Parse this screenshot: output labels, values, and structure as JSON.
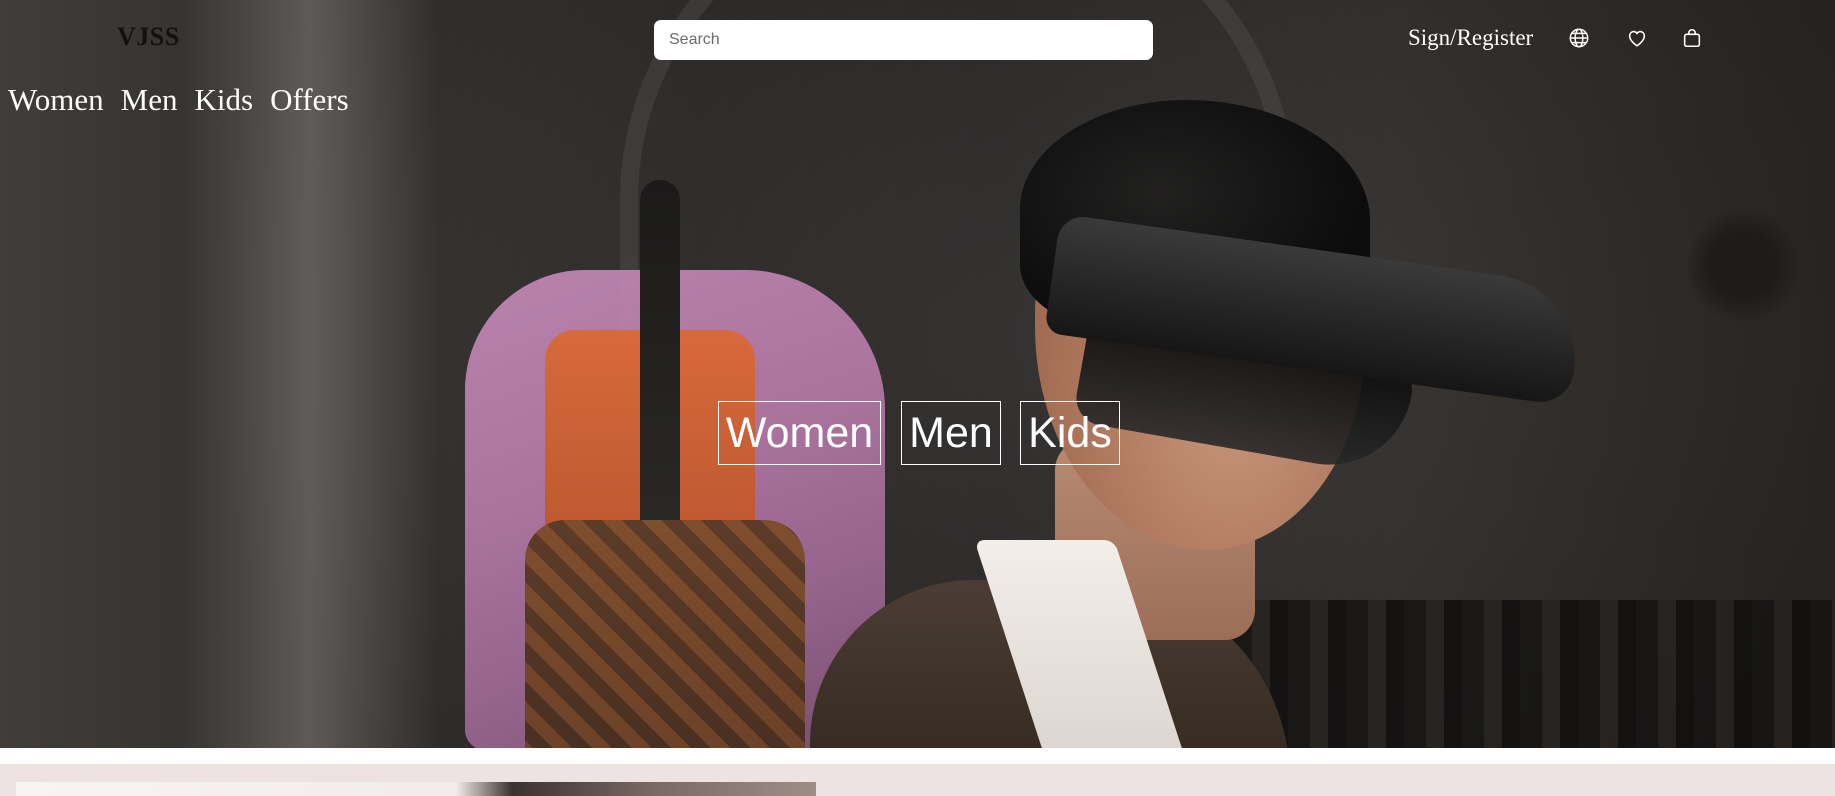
{
  "header": {
    "logo": "VJSS",
    "search_placeholder": "Search",
    "sign_register": "Sign/Register"
  },
  "icons": {
    "language": "globe-icon",
    "wishlist": "heart-icon",
    "bag": "shopping-bag-icon"
  },
  "nav": {
    "items": [
      "Women",
      "Men",
      "Kids",
      "Offers"
    ]
  },
  "hero": {
    "categories": [
      "Women",
      "Men",
      "Kids"
    ]
  },
  "colors": {
    "text_on_hero": "#ffffff",
    "logo": "#111111",
    "below_fold_bg": "#ede3e2"
  }
}
